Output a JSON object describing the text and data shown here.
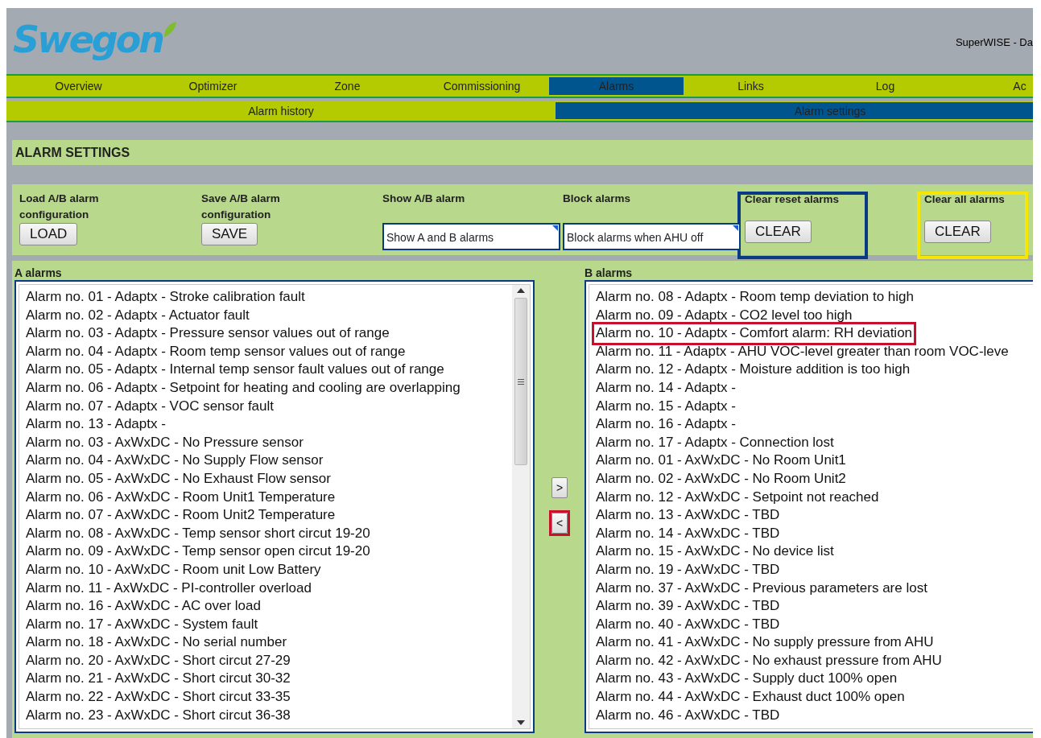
{
  "header": {
    "logo": "Swegon",
    "title": "SuperWISE - Da"
  },
  "nav": [
    {
      "label": "Overview",
      "selected": false
    },
    {
      "label": "Optimizer",
      "selected": false
    },
    {
      "label": "Zone",
      "selected": false
    },
    {
      "label": "Commissioning",
      "selected": false
    },
    {
      "label": "Alarms",
      "selected": true
    },
    {
      "label": "Links",
      "selected": false
    },
    {
      "label": "Log",
      "selected": false
    },
    {
      "label": "Ac",
      "selected": false
    }
  ],
  "subnav": [
    {
      "label": "Alarm history",
      "selected": false
    },
    {
      "label": "Alarm settings",
      "selected": true
    }
  ],
  "section_title": "ALARM SETTINGS",
  "controls": [
    {
      "kind": "button",
      "label": "Load A/B alarm configuration",
      "value": "LOAD"
    },
    {
      "kind": "button",
      "label": "Save A/B alarm configuration",
      "value": "SAVE"
    },
    {
      "kind": "dropdown",
      "label": "Show A/B alarm",
      "value": "Show A and B alarms"
    },
    {
      "kind": "dropdown",
      "label": "Block alarms",
      "value": "Block alarms when AHU off"
    },
    {
      "kind": "button",
      "label": "Clear reset alarms",
      "value": "CLEAR",
      "color": "#0b3a84"
    },
    {
      "kind": "button",
      "label": "Clear all alarms",
      "value": "CLEAR",
      "color": "#f7e600"
    }
  ],
  "a_alarms": {
    "title": "A alarms",
    "items": [
      {
        "text": "Alarm no. 01 - Adaptx - Stroke calibration fault"
      },
      {
        "text": "Alarm no. 02 - Adaptx - Actuator fault"
      },
      {
        "text": "Alarm no. 03 - Adaptx - Pressure sensor values out of range"
      },
      {
        "text": "Alarm no. 04 - Adaptx - Room temp sensor values out of range"
      },
      {
        "text": "Alarm no. 05 - Adaptx - Internal temp sensor fault values out of range"
      },
      {
        "text": "Alarm no. 06 - Adaptx - Setpoint for heating and cooling are overlapping"
      },
      {
        "text": "Alarm no. 07 - Adaptx - VOC sensor fault"
      },
      {
        "text": "Alarm no. 13 - Adaptx -"
      },
      {
        "text": "Alarm no. 03 - AxWxDC - No Pressure sensor"
      },
      {
        "text": "Alarm no. 04 - AxWxDC - No Supply Flow sensor"
      },
      {
        "text": "Alarm no. 05 - AxWxDC - No Exhaust Flow sensor"
      },
      {
        "text": "Alarm no. 06 - AxWxDC - Room Unit1 Temperature"
      },
      {
        "text": "Alarm no. 07 - AxWxDC - Room Unit2 Temperature"
      },
      {
        "text": "Alarm no. 08 - AxWxDC - Temp sensor short circut 19-20"
      },
      {
        "text": "Alarm no. 09 - AxWxDC - Temp sensor open circut 19-20"
      },
      {
        "text": "Alarm no. 10 - AxWxDC - Room unit Low Battery"
      },
      {
        "text": "Alarm no. 11 - AxWxDC - PI-controller overload"
      },
      {
        "text": "Alarm no. 16 - AxWxDC - AC over load"
      },
      {
        "text": "Alarm no. 17 - AxWxDC - System fault"
      },
      {
        "text": "Alarm no. 18 - AxWxDC - No serial number"
      },
      {
        "text": "Alarm no. 20 - AxWxDC - Short circut 27-29"
      },
      {
        "text": "Alarm no. 21 - AxWxDC - Short circut 30-32"
      },
      {
        "text": "Alarm no. 22 - AxWxDC - Short circut 33-35"
      },
      {
        "text": "Alarm no. 23 - AxWxDC - Short circut 36-38"
      }
    ]
  },
  "move_buttons": [
    {
      "label": ">"
    },
    {
      "label": "<",
      "color": "#c8102e"
    }
  ],
  "b_alarms": {
    "title": "B alarms",
    "items": [
      {
        "text": "Alarm no. 08 - Adaptx - Room temp deviation to high"
      },
      {
        "text": "Alarm no. 09 - Adaptx - CO2 level too high"
      },
      {
        "text": "Alarm no. 10 - Adaptx - Comfort alarm: RH deviation",
        "color": "#c8102e"
      },
      {
        "text": "Alarm no. 11 - Adaptx - AHU VOC-level greater than room VOC-leve"
      },
      {
        "text": "Alarm no. 12 - Adaptx - Moisture addition is too high"
      },
      {
        "text": "Alarm no. 14 - Adaptx -"
      },
      {
        "text": "Alarm no. 15 - Adaptx -"
      },
      {
        "text": "Alarm no. 16 - Adaptx -"
      },
      {
        "text": "Alarm no. 17 - Adaptx - Connection lost"
      },
      {
        "text": "Alarm no. 01 - AxWxDC - No Room Unit1"
      },
      {
        "text": "Alarm no. 02 - AxWxDC - No Room Unit2"
      },
      {
        "text": "Alarm no. 12 - AxWxDC - Setpoint not reached"
      },
      {
        "text": "Alarm no. 13 - AxWxDC - TBD"
      },
      {
        "text": "Alarm no. 14 - AxWxDC - TBD"
      },
      {
        "text": "Alarm no. 15 - AxWxDC - No device list"
      },
      {
        "text": "Alarm no. 19 - AxWxDC - TBD"
      },
      {
        "text": "Alarm no. 37 - AxWxDC - Previous parameters are lost"
      },
      {
        "text": "Alarm no. 39 - AxWxDC - TBD"
      },
      {
        "text": "Alarm no. 40 - AxWxDC - TBD"
      },
      {
        "text": "Alarm no. 41 - AxWxDC - No supply pressure from AHU"
      },
      {
        "text": "Alarm no. 42 - AxWxDC - No exhaust pressure from AHU"
      },
      {
        "text": "Alarm no. 43 - AxWxDC - Supply duct 100% open"
      },
      {
        "text": "Alarm no. 44 - AxWxDC - Exhaust duct 100% open"
      },
      {
        "text": "Alarm no. 46 - AxWxDC - TBD"
      }
    ]
  }
}
